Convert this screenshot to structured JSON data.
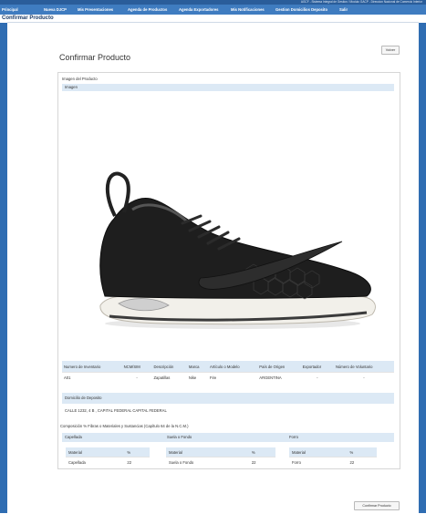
{
  "system": {
    "title": "AGCF - Sistema Integral de Gestion / Modulo GACP - Direccion Nacional de Comercio Interior"
  },
  "nav": {
    "items": [
      "Principal",
      "Nueva DJCP",
      "Mis Presentaciones",
      "Agenda de Productos",
      "Agenda Exportadores",
      "Mis Notificaciones",
      "Gestion Domicilios Deposito",
      "Salir"
    ]
  },
  "page": {
    "title": "Confirmar Producto"
  },
  "actions": {
    "back": "Volver",
    "confirm": "Confirmar Producto"
  },
  "main": {
    "heading": "Confirmar Producto"
  },
  "image_section": {
    "title": "Imagen del Producto",
    "band": "Imagen"
  },
  "product_table": {
    "headers": [
      "Numero de Inventario",
      "NCM/SIM",
      "Descripción",
      "Marca",
      "Artículo o Modelo",
      "País de Origen",
      "Exportador",
      "Número de Voluntario"
    ],
    "row": [
      "A01",
      "-",
      "Zapatillas",
      "Nike",
      "Fire",
      "ARGENTINA",
      "-",
      "-"
    ]
  },
  "deposit": {
    "title": "Domicilio de Deposito",
    "value": "CALLE 1232, 4 B , CAPITAL FEDERAL CAPITAL FEDERAL"
  },
  "composition": {
    "title": "Composición % Fibras o Materiales y Sustancias (Capítulo 64 de la N.C.M.)",
    "sections": [
      {
        "name": "Capellada",
        "headers": [
          "Material",
          "%"
        ],
        "row": [
          "Capellada",
          "22"
        ]
      },
      {
        "name": "Suela o Fondo",
        "headers": [
          "Material",
          "%"
        ],
        "row": [
          "Suela o Fondo",
          "22"
        ]
      },
      {
        "name": "Forro",
        "headers": [
          "Material",
          "%"
        ],
        "row": [
          "Forro",
          "22"
        ]
      }
    ]
  },
  "icons": {
    "shoe": "product-photo-sneaker"
  },
  "colors": {
    "nav": "#3f7cc0",
    "sidebar": "#2f6db2",
    "band": "#dce9f5"
  }
}
